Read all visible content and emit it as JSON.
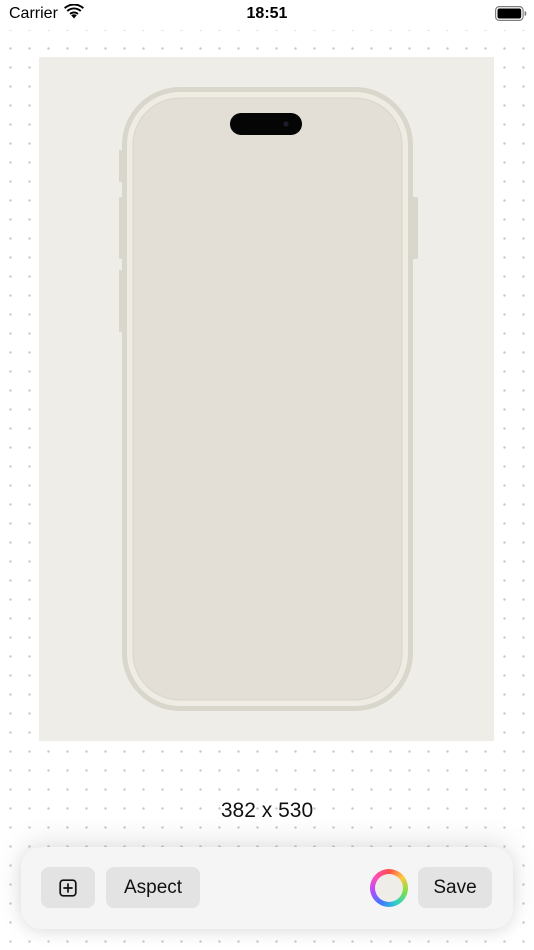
{
  "status_bar": {
    "carrier": "Carrier",
    "time": "18:51"
  },
  "canvas": {
    "background_color": "#eeede7",
    "mockup_frame_color": "#d9d6cb",
    "mockup_screen_color": "#e3dfd7"
  },
  "size_label": "382 x 530",
  "toolbar": {
    "add_icon": "plus-square-icon",
    "aspect_label": "Aspect",
    "color_icon": "color-wheel-icon",
    "save_label": "Save"
  }
}
